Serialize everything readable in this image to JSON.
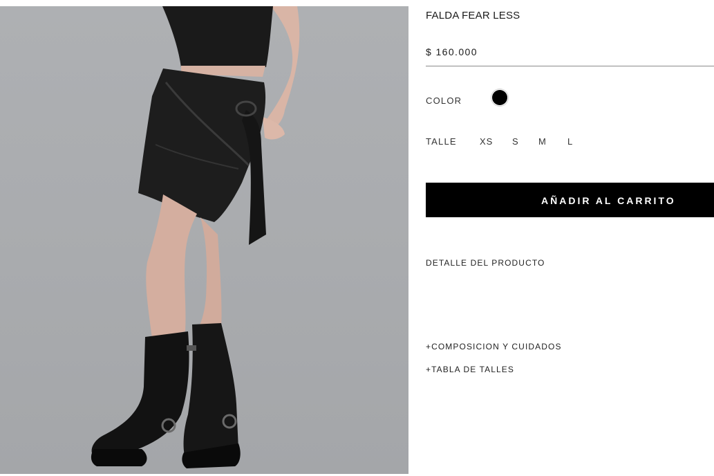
{
  "product": {
    "title": "FALDA FEAR LESS",
    "price": "$ 160.000"
  },
  "options": {
    "color_label": "COLOR",
    "color_swatch": "#000000",
    "size_label": "TALLE",
    "sizes": [
      "XS",
      "S",
      "M",
      "L"
    ]
  },
  "actions": {
    "add_to_cart": "AÑADIR AL CARRITO"
  },
  "details": {
    "heading": "DETALLE DEL PRODUCTO",
    "accordions": [
      "+COMPOSICION Y CUIDADOS",
      "+TABLA DE TALLES"
    ]
  }
}
